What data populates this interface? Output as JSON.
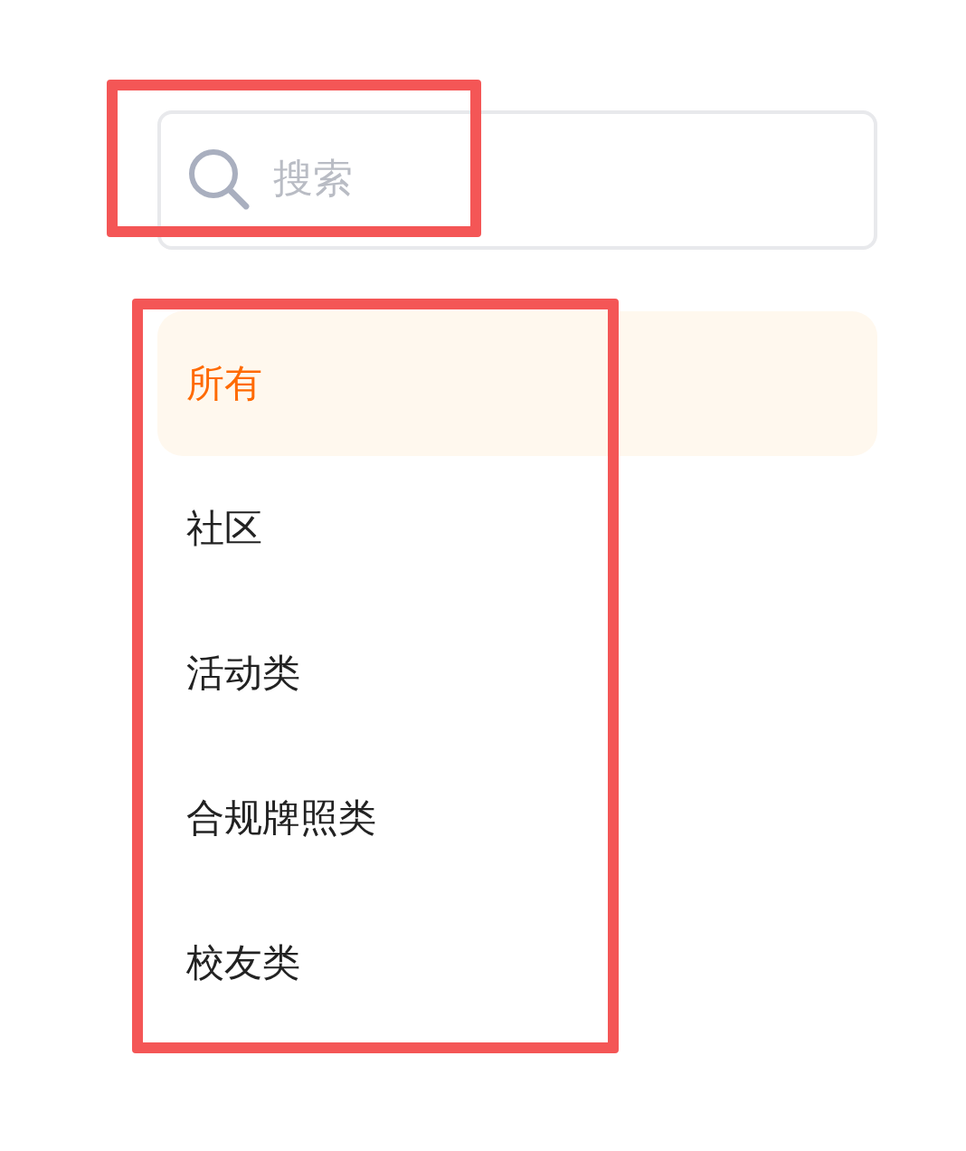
{
  "search": {
    "placeholder": "搜索",
    "highlighted": true
  },
  "category_list": {
    "highlighted": true,
    "items": [
      {
        "label": "所有",
        "selected": true
      },
      {
        "label": "社区",
        "selected": false
      },
      {
        "label": "活动类",
        "selected": false
      },
      {
        "label": "合规牌照类",
        "selected": false
      },
      {
        "label": "校友类",
        "selected": false
      }
    ]
  }
}
